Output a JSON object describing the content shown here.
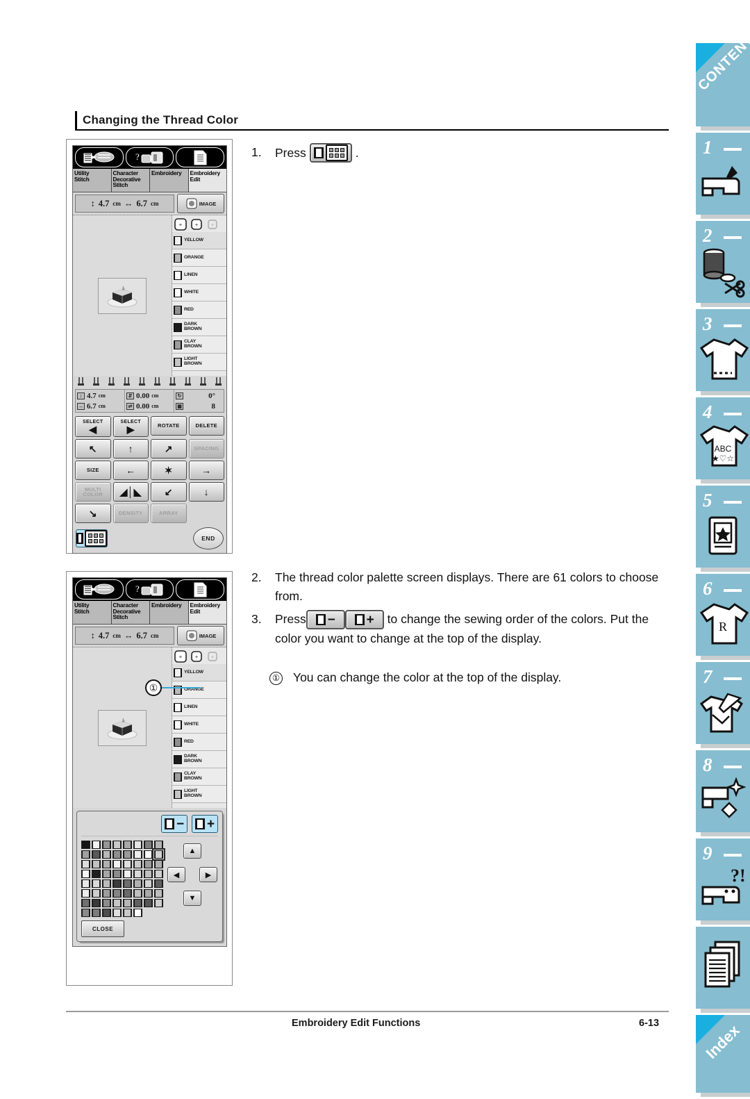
{
  "section": {
    "title": "Changing the Thread Color"
  },
  "steps": {
    "s1": {
      "num": "1.",
      "text_before": "Press",
      "text_after": "."
    },
    "s2": {
      "num": "2.",
      "text": "The thread color palette screen displays. There are 61 colors to choose from."
    },
    "s3": {
      "num": "3.",
      "text_before": "Press",
      "text_mid": "to change the sewing order of the colors. Put the color you want to change at the top of the display."
    },
    "callout": {
      "marker": "①",
      "text": "You can change the color at the top of the display."
    }
  },
  "lcd": {
    "tabs": [
      {
        "label": "Utility\nStitch",
        "icon": "needle-plate-icon"
      },
      {
        "label": "Character\nDecorative\nStitch",
        "icon": "question-machine-icon"
      },
      {
        "label": "Embroidery",
        "icon": "document-list-icon"
      },
      {
        "label": "Embroidery\nEdit",
        "icon": "document-list-icon"
      }
    ],
    "size": {
      "height_value": "4.7",
      "height_unit": "cm",
      "width_value": "6.7",
      "width_unit": "cm",
      "image_label": "IMAGE"
    },
    "colors": [
      {
        "name": "YELLOW",
        "hex": "#f0f0f0"
      },
      {
        "name": "ORANGE",
        "hex": "#b8b8b8"
      },
      {
        "name": "LINEN",
        "hex": "#fbfbfb"
      },
      {
        "name": "WHITE",
        "hex": "#ffffff"
      },
      {
        "name": "RED",
        "hex": "#8f8f8f"
      },
      {
        "name": "DARK BROWN",
        "hex": "#1c1c1c"
      },
      {
        "name": "CLAY BROWN",
        "hex": "#9d9d9d"
      },
      {
        "name": "LIGHT BROWN",
        "hex": "#c4c4c4"
      }
    ],
    "readout": {
      "r1c1": "4.7",
      "r1c1u": "cm",
      "r2c1": "6.7",
      "r2c1u": "cm",
      "r1c2": "0.00",
      "r1c2u": "cm",
      "r2c2": "0.00",
      "r2c2u": "cm",
      "r1c3": "0°",
      "r2c3": "8"
    },
    "buttons": [
      {
        "label": "SELECT",
        "sub": "◀",
        "enabled": true,
        "name": "select-prev-button"
      },
      {
        "label": "SELECT",
        "sub": "▶",
        "enabled": true,
        "name": "select-next-button"
      },
      {
        "label": "ROTATE",
        "sub": "",
        "enabled": true,
        "name": "rotate-button"
      },
      {
        "label": "DELETE",
        "sub": "",
        "enabled": true,
        "name": "delete-button"
      },
      {
        "label": "↖",
        "sub": "",
        "enabled": true,
        "name": "move-up-left-button"
      },
      {
        "label": "↑",
        "sub": "",
        "enabled": true,
        "name": "move-up-button"
      },
      {
        "label": "↗",
        "sub": "",
        "enabled": true,
        "name": "move-up-right-button"
      },
      {
        "label": "SPACING",
        "sub": "",
        "enabled": false,
        "name": "spacing-button"
      },
      {
        "label": "SIZE",
        "sub": "",
        "enabled": true,
        "name": "size-button"
      },
      {
        "label": "←",
        "sub": "",
        "enabled": true,
        "name": "move-left-button"
      },
      {
        "label": "✶",
        "sub": "",
        "enabled": true,
        "name": "center-button"
      },
      {
        "label": "→",
        "sub": "",
        "enabled": true,
        "name": "move-right-button"
      },
      {
        "label": "MULTI COLOR",
        "sub": "",
        "enabled": false,
        "name": "multi-color-button"
      },
      {
        "label": "◢│◣",
        "sub": "",
        "enabled": true,
        "name": "mirror-button"
      },
      {
        "label": "↙",
        "sub": "",
        "enabled": true,
        "name": "move-down-left-button"
      },
      {
        "label": "↓",
        "sub": "",
        "enabled": true,
        "name": "move-down-button"
      },
      {
        "label": "↘",
        "sub": "",
        "enabled": true,
        "name": "move-down-right-button"
      },
      {
        "label": "DENSITY",
        "sub": "",
        "enabled": false,
        "name": "density-button"
      },
      {
        "label": "ARRAY",
        "sub": "",
        "enabled": false,
        "name": "array-button"
      }
    ],
    "end_label": "END",
    "palette": {
      "minus_label": "−",
      "plus_label": "+",
      "close_label": "CLOSE",
      "columns": 8,
      "count": 61,
      "selected_index": 15,
      "swatches": [
        "#141414",
        "#f4f4f4",
        "#969696",
        "#c9c9c9",
        "#a8a8a8",
        "#e6e6e6",
        "#808080",
        "#b4b4b4",
        "#a0a0a0",
        "#5a5a5a",
        "#b8b8b8",
        "#8f8f8f",
        "#9a9a9a",
        "#efefef",
        "#fafafa",
        "#d2d2d2",
        "#dcdcdc",
        "#c2c2c2",
        "#b0b0b0",
        "#f2f2f2",
        "#e0e0e0",
        "#cacaca",
        "#9d9d9d",
        "#aeaeae",
        "#f6f6f6",
        "#1f1f1f",
        "#a6a6a6",
        "#8b8b8b",
        "#efefef",
        "#d8d8d8",
        "#bfbfbf",
        "#cfcfcf",
        "#e8e8e8",
        "#dadada",
        "#bcbcbc",
        "#3c3c3c",
        "#6e6e6e",
        "#b2b2b2",
        "#d4d4d4",
        "#5f5f5f",
        "#ededed",
        "#cecece",
        "#9e9e9e",
        "#868686",
        "#6b6b6b",
        "#c0c0c0",
        "#ababab",
        "#bdbdbd",
        "#707070",
        "#3a3a3a",
        "#8c8c8c",
        "#c6c6c6",
        "#b6b6b6",
        "#606060",
        "#565656",
        "#cdcdcd",
        "#8a8a8a",
        "#7c7c7c",
        "#4e4e4e",
        "#dfdfdf",
        "#c8c8c8",
        "#ffffff"
      ]
    }
  },
  "sidebar": {
    "contents_label": "CONTENTS",
    "index_label": "Index",
    "tabs": [
      {
        "num": "1",
        "icon": "sewing-machine-icon"
      },
      {
        "num": "2",
        "icon": "thread-spool-scissors-icon"
      },
      {
        "num": "3",
        "icon": "tshirt-icon"
      },
      {
        "num": "4",
        "icon": "tshirt-abc-icon"
      },
      {
        "num": "5",
        "icon": "card-star-icon"
      },
      {
        "num": "6",
        "icon": "tshirt-letter-icon"
      },
      {
        "num": "7",
        "icon": "tshirt-pen-icon"
      },
      {
        "num": "8",
        "icon": "machine-sparkle-icon"
      },
      {
        "num": "9",
        "icon": "machine-question-icon"
      }
    ],
    "plain_tab_icon": "pages-icon",
    "accent": "#19b0e0",
    "tab_color": "#86bdd0"
  },
  "footer": {
    "left": "Embroidery Edit Functions",
    "right": "6-13"
  }
}
